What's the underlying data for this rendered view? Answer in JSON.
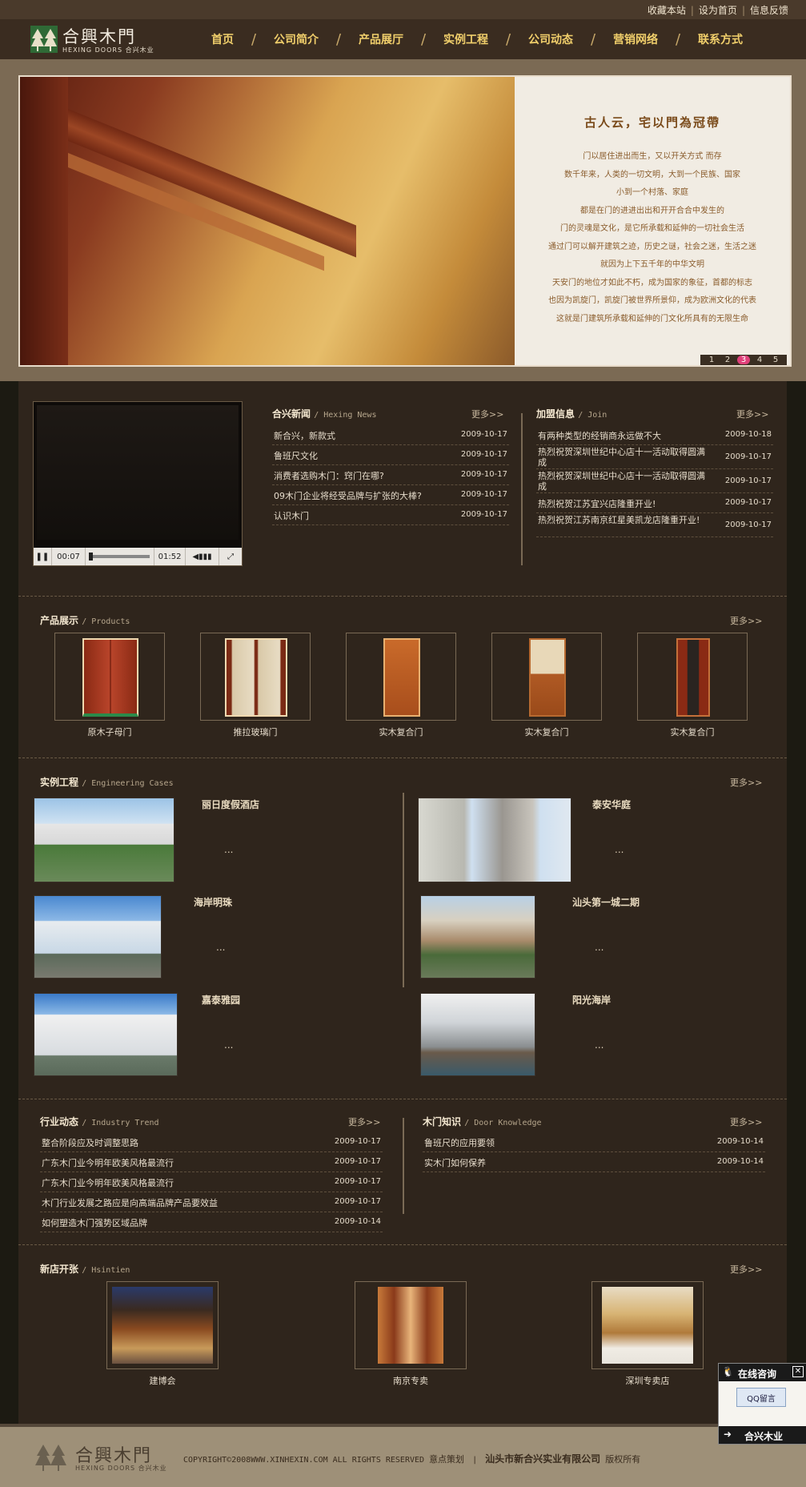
{
  "toplinks": {
    "bookmark": "收藏本站",
    "homepage": "设为首页",
    "feedback": "信息反馈"
  },
  "logo": {
    "cn": "合興木門",
    "en": "HEXING DOORS",
    "en2": "合兴木业"
  },
  "nav": [
    "首页",
    "公司简介",
    "产品展厅",
    "实例工程",
    "公司动态",
    "营销网络",
    "联系方式"
  ],
  "banner": {
    "title": "古人云，宅以門為冠帶",
    "lines": [
      "门以居住进出而生，又以开关方式 而存",
      "数千年来，人类的一切文明，大到一个民族、国家",
      "小到一个村落、家庭",
      "都是在门的进进出出和开开合合中发生的",
      "门的灵魂是文化，是它所承载和延伸的一切社会生活",
      "通过门可以解开建筑之迹，历史之谜，社会之迷，生活之迷",
      "就因为上下五千年的中华文明",
      "天安门的地位才如此不朽，成为国家的象征，首都的标志",
      "也因为凯旋门，凯旋门被世界所景仰，成为欧洲文化的代表",
      "这就是门建筑所承载和延伸的门文化所具有的无限生命"
    ],
    "pages": [
      "1",
      "2",
      "3",
      "4",
      "5"
    ],
    "active_page": "3"
  },
  "video": {
    "current": "00:07",
    "total": "01:52"
  },
  "news": {
    "title": "合兴新闻",
    "en": "Hexing News",
    "more": "更多>>",
    "items": [
      {
        "t": "新合兴，新款式",
        "d": "2009-10-17"
      },
      {
        "t": "鲁班尺文化",
        "d": "2009-10-17"
      },
      {
        "t": "消费者选购木门：窍门在哪?",
        "d": "2009-10-17"
      },
      {
        "t": "09木门企业将经受品牌与扩张的大棒?",
        "d": "2009-10-17"
      },
      {
        "t": "认识木门",
        "d": "2009-10-17"
      }
    ]
  },
  "join": {
    "title": "加盟信息",
    "en": "Join",
    "more": "更多>>",
    "items": [
      {
        "t": "有两种类型的经销商永远做不大",
        "d": "2009-10-18"
      },
      {
        "t": "热烈祝贺深圳世纪中心店十一活动取得圆满成",
        "d": "2009-10-17"
      },
      {
        "t": "热烈祝贺深圳世纪中心店十一活动取得圆满成",
        "d": "2009-10-17"
      },
      {
        "t": "热烈祝贺江苏宜兴店隆重开业!",
        "d": "2009-10-17"
      },
      {
        "t": "热烈祝贺江苏南京红星美凯龙店隆重开业!",
        "d": "2009-10-17"
      }
    ]
  },
  "products": {
    "title": "产品展示",
    "en": "Products",
    "more": "更多>>",
    "items": [
      "原木子母门",
      "推拉玻璃门",
      "实木复合门",
      "实木复合门",
      "实木复合门"
    ]
  },
  "cases": {
    "title": "实例工程",
    "en": "Engineering Cases",
    "more": "更多>>",
    "items": [
      {
        "name": "丽日度假酒店",
        "dots": "..."
      },
      {
        "name": "泰安华庭",
        "dots": "..."
      },
      {
        "name": "海岸明珠",
        "dots": "..."
      },
      {
        "name": "汕头第一城二期",
        "dots": "..."
      },
      {
        "name": "嘉泰雅园",
        "dots": "..."
      },
      {
        "name": "阳光海岸",
        "dots": "..."
      }
    ]
  },
  "trend": {
    "title": "行业动态",
    "en": "Industry Trend",
    "more": "更多>>",
    "items": [
      {
        "t": "整合阶段应及时调整思路",
        "d": "2009-10-17"
      },
      {
        "t": "广东木门业今明年欧美风格最流行",
        "d": "2009-10-17"
      },
      {
        "t": "广东木门业今明年欧美风格最流行",
        "d": "2009-10-17"
      },
      {
        "t": "木门行业发展之路应是向高端品牌产品要效益",
        "d": "2009-10-17"
      },
      {
        "t": "如何塑造木门强势区域品牌",
        "d": "2009-10-14"
      }
    ]
  },
  "knowledge": {
    "title": "木门知识",
    "en": "Door Knowledge",
    "more": "更多>>",
    "items": [
      {
        "t": "鲁班尺的应用要领",
        "d": "2009-10-14"
      },
      {
        "t": "实木门如何保养",
        "d": "2009-10-14"
      }
    ]
  },
  "shops": {
    "title": "新店开张",
    "en": "Hsintien",
    "more": "更多>>",
    "items": [
      "建博会",
      "南京专卖",
      "深圳专卖店"
    ]
  },
  "footer": {
    "copyright": "COPYRIGHT©2008WWW.XINHEXIN.COM ALL RIGHTS RESERVED",
    "design": "意点策划",
    "company": "汕头市新合兴实业有限公司",
    "rights": "版权所有"
  },
  "qq": {
    "head": "在线咨询",
    "button": "QQ留言",
    "foot": "合兴木业"
  }
}
